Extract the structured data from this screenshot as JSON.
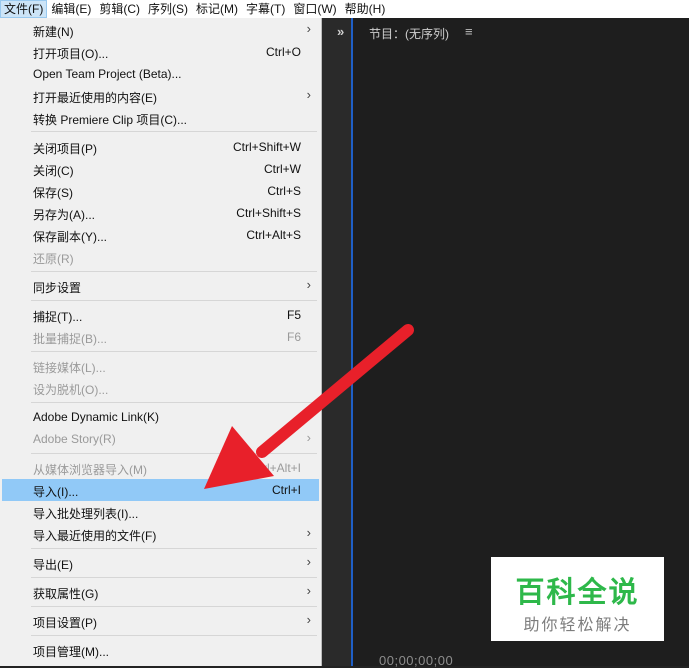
{
  "menubar": [
    {
      "label": "文件(F)",
      "active": true
    },
    {
      "label": "编辑(E)"
    },
    {
      "label": "剪辑(C)"
    },
    {
      "label": "序列(S)"
    },
    {
      "label": "标记(M)"
    },
    {
      "label": "字幕(T)"
    },
    {
      "label": "窗口(W)"
    },
    {
      "label": "帮助(H)"
    }
  ],
  "file_menu": {
    "new": {
      "label": "新建(N)"
    },
    "open_project": {
      "label": "打开项目(O)...",
      "shortcut": "Ctrl+O"
    },
    "open_team_project": {
      "label": "Open Team Project (Beta)..."
    },
    "open_recent": {
      "label": "打开最近使用的内容(E)"
    },
    "convert_premiere_clip": {
      "label": "转换 Premiere Clip 项目(C)..."
    },
    "close_project": {
      "label": "关闭项目(P)",
      "shortcut": "Ctrl+Shift+W"
    },
    "close": {
      "label": "关闭(C)",
      "shortcut": "Ctrl+W"
    },
    "save": {
      "label": "保存(S)",
      "shortcut": "Ctrl+S"
    },
    "save_as": {
      "label": "另存为(A)...",
      "shortcut": "Ctrl+Shift+S"
    },
    "save_copy": {
      "label": "保存副本(Y)...",
      "shortcut": "Ctrl+Alt+S"
    },
    "revert": {
      "label": "还原(R)"
    },
    "sync_settings": {
      "label": "同步设置"
    },
    "capture": {
      "label": "捕捉(T)...",
      "shortcut": "F5"
    },
    "batch_capture": {
      "label": "批量捕捉(B)...",
      "shortcut": "F6"
    },
    "link_media": {
      "label": "链接媒体(L)..."
    },
    "make_offline": {
      "label": "设为脱机(O)..."
    },
    "dynamic_link": {
      "label": "Adobe Dynamic Link(K)"
    },
    "adobe_story": {
      "label": "Adobe Story(R)"
    },
    "import_from_browser": {
      "label": "从媒体浏览器导入(M)",
      "shortcut": "Ctrl+Alt+I"
    },
    "import": {
      "label": "导入(I)...",
      "shortcut": "Ctrl+I"
    },
    "import_batch_list": {
      "label": "导入批处理列表(I)..."
    },
    "import_recent": {
      "label": "导入最近使用的文件(F)"
    },
    "export": {
      "label": "导出(E)"
    },
    "get_properties": {
      "label": "获取属性(G)"
    },
    "project_settings": {
      "label": "项目设置(P)"
    },
    "project_manager": {
      "label": "项目管理(M)..."
    }
  },
  "program_panel": {
    "expand_glyph": "»",
    "title": "节目：(无序列)",
    "menu_glyph": "≡",
    "timecode": "00;00;00;00"
  },
  "watermark": {
    "title": "百科全说",
    "subtitle": "助你轻松解决"
  },
  "colors": {
    "highlight": "#91c9f7",
    "arrow": "#e8202a",
    "watermark_green": "#2eb84a",
    "panel_border": "#1f5fc7"
  },
  "icons": {
    "submenu": "chevron-right-icon",
    "arrow": "red-arrow-annotation"
  }
}
